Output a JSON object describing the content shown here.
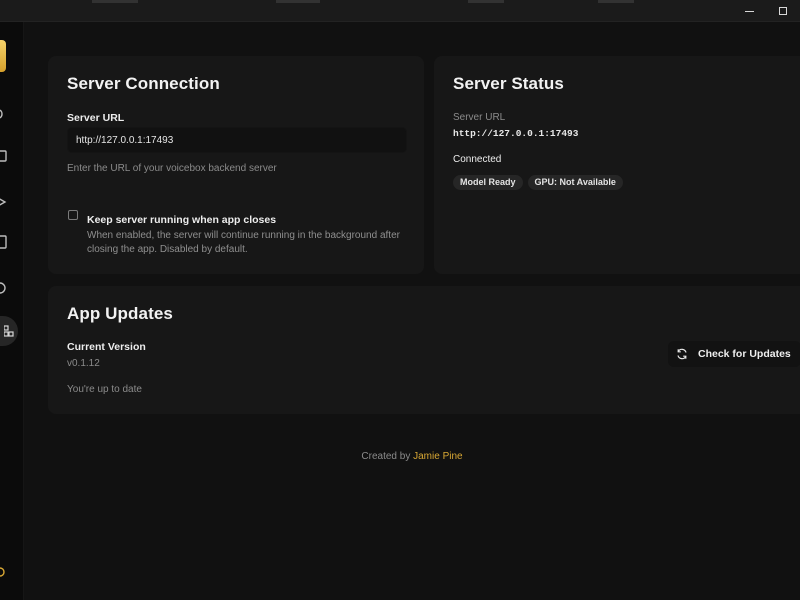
{
  "window": {
    "minimize_label": "Minimize",
    "maximize_label": "Maximize"
  },
  "colors": {
    "background": "#111111",
    "card": "#171717",
    "accent": "#d9a834",
    "muted_text": "#8b8b8b"
  },
  "server_connection": {
    "title": "Server Connection",
    "url_label": "Server URL",
    "url_value": "http://127.0.0.1:17493",
    "url_help": "Enter the URL of your voicebox backend server",
    "keep_running_label": "Keep server running when app closes",
    "keep_running_checked": false,
    "keep_running_desc_1": "When enabled, the server will continue running in the background after",
    "keep_running_desc_2": "closing the app. Disabled by default."
  },
  "server_status": {
    "title": "Server Status",
    "url_label": "Server URL",
    "url_value": "http://127.0.0.1:17493",
    "status": "Connected",
    "badges": [
      "Model Ready",
      "GPU: Not Available"
    ]
  },
  "app_updates": {
    "title": "App Updates",
    "version_label": "Current Version",
    "version_value": "v0.1.12",
    "status_text": "You're up to date",
    "check_button": "Check for Updates"
  },
  "footer": {
    "prefix": "Created by",
    "author": "Jamie Pine"
  },
  "sidebar": {
    "icons": [
      "logo-icon",
      "audio-icon",
      "box-icon",
      "mic-icon",
      "document-icon",
      "wave-icon",
      "settings-grid-icon",
      "bottom-icon"
    ]
  }
}
